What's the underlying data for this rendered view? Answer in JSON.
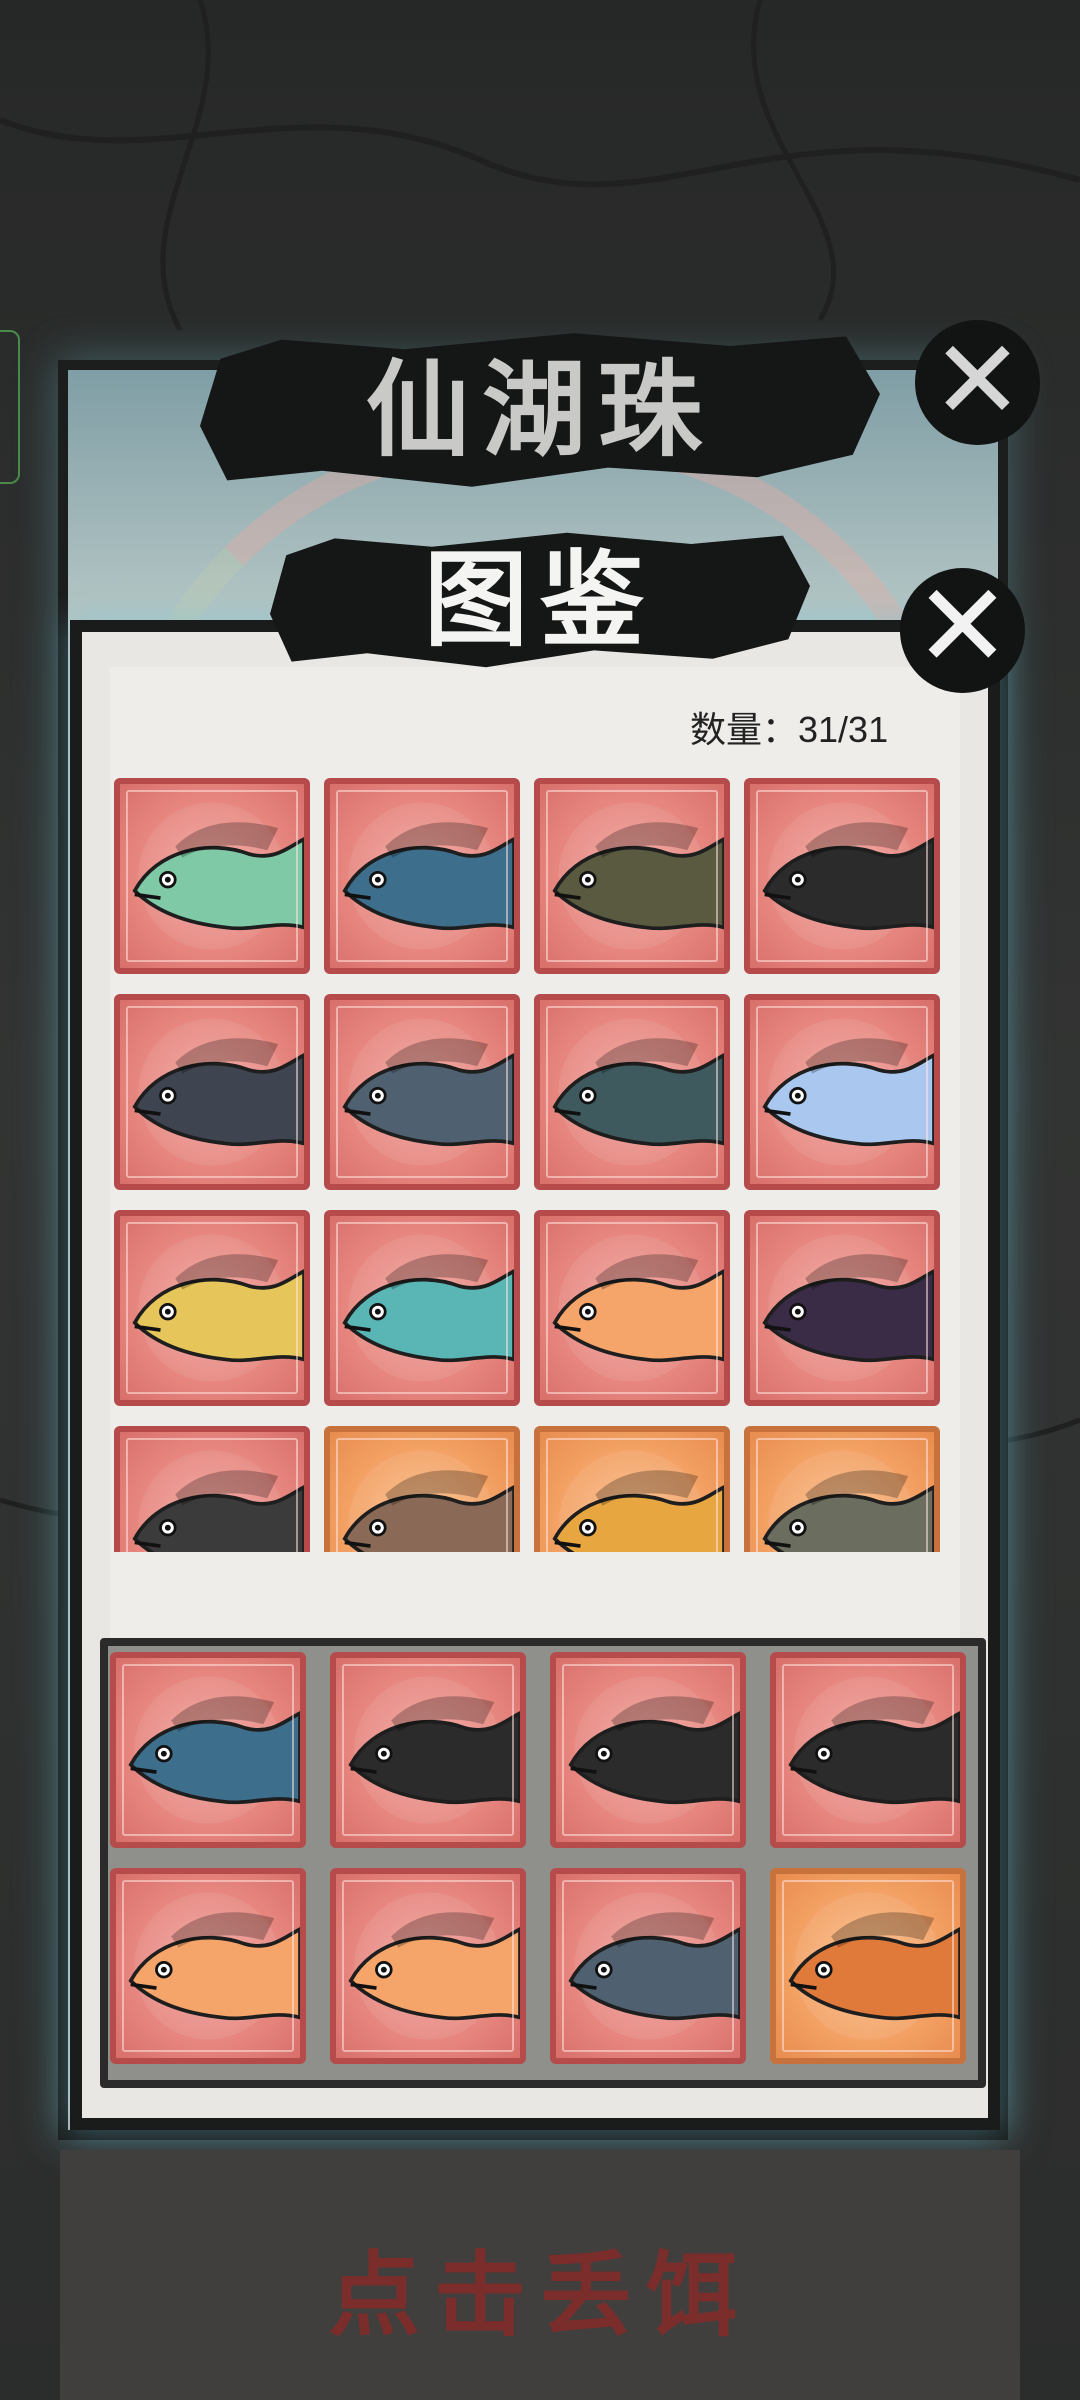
{
  "back_panel": {
    "title": "仙湖珠"
  },
  "front_panel": {
    "title": "图鉴",
    "count_label": "数量：",
    "count_value": "31/31"
  },
  "collection_grid": [
    {
      "creature": "green-dragon",
      "frame": "red",
      "color": "#7fc9a6"
    },
    {
      "creature": "red-maned-beast",
      "frame": "red",
      "color": "#3d6e8c"
    },
    {
      "creature": "snapping-turtle",
      "frame": "red",
      "color": "#5a5a40"
    },
    {
      "creature": "black-gold-fish",
      "frame": "red",
      "color": "#2b2b2b"
    },
    {
      "creature": "whale-shark-mouth",
      "frame": "red",
      "color": "#3e4450"
    },
    {
      "creature": "spotted-whale",
      "frame": "red",
      "color": "#4f6070"
    },
    {
      "creature": "fanged-sea-monster",
      "frame": "red",
      "color": "#3e5a5e"
    },
    {
      "creature": "blue-fish",
      "frame": "red",
      "color": "#a9c7ef"
    },
    {
      "creature": "golden-sea-dragon",
      "frame": "red",
      "color": "#e6c65a"
    },
    {
      "creature": "antlered-fish",
      "frame": "red",
      "color": "#59b6b4"
    },
    {
      "creature": "flame-goldfish",
      "frame": "red",
      "color": "#f5a46a"
    },
    {
      "creature": "purple-shark",
      "frame": "red",
      "color": "#3a2c46"
    },
    {
      "creature": "anglerfish",
      "frame": "red",
      "color": "#3b3b3b"
    },
    {
      "creature": "tiger-shark",
      "frame": "orange",
      "color": "#8a6a56"
    },
    {
      "creature": "golden-carp",
      "frame": "orange",
      "color": "#e8a640"
    },
    {
      "creature": "grey-catfish",
      "frame": "orange",
      "color": "#6b6d5e"
    }
  ],
  "tray_items": [
    {
      "creature": "red-maned-beast",
      "frame": "red",
      "color": "#3d6e8c"
    },
    {
      "creature": "black-gold-fish",
      "frame": "red",
      "color": "#2b2b2b"
    },
    {
      "creature": "black-gold-fish",
      "frame": "red",
      "color": "#2b2b2b"
    },
    {
      "creature": "black-gold-fish",
      "frame": "red",
      "color": "#2b2b2b"
    },
    {
      "creature": "flame-goldfish",
      "frame": "red",
      "color": "#f5a46a"
    },
    {
      "creature": "flame-goldfish",
      "frame": "red",
      "color": "#f5a46a"
    },
    {
      "creature": "spotted-whale",
      "frame": "red",
      "color": "#4f6070"
    },
    {
      "creature": "lionfish",
      "frame": "orange",
      "color": "#e07a3a"
    }
  ],
  "bait_button": {
    "label": "点击丢饵"
  },
  "close_icon": "close-icon"
}
